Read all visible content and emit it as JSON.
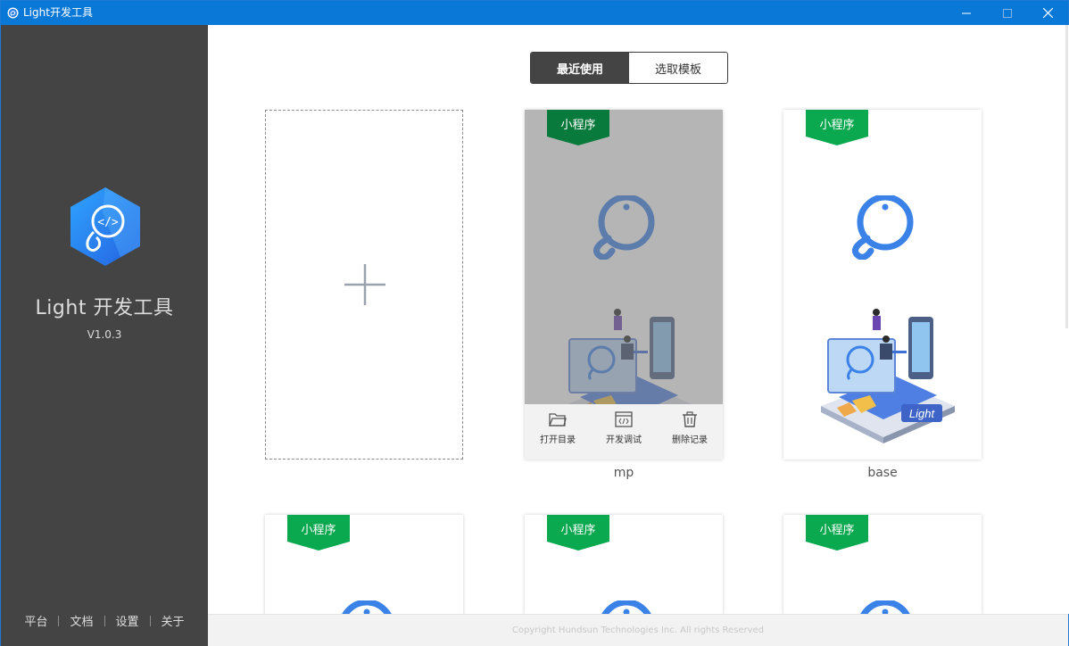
{
  "window": {
    "title": "Light开发工具",
    "controls": {
      "minimize": "minimize-icon",
      "maximize": "maximize-icon",
      "close": "close-icon"
    }
  },
  "sidebar": {
    "app_name": "Light 开发工具",
    "version": "V1.0.3",
    "links": [
      "平台",
      "文档",
      "设置",
      "关于"
    ]
  },
  "tabs": {
    "recent": "最近使用",
    "template": "选取模板",
    "active": "recent"
  },
  "cards": [
    {
      "badge": "小程序",
      "name": "mp",
      "hovered": true,
      "actions": [
        {
          "label": "打开目录",
          "icon": "folder-icon"
        },
        {
          "label": "开发调试",
          "icon": "code-icon"
        },
        {
          "label": "删除记录",
          "icon": "trash-icon"
        }
      ]
    },
    {
      "badge": "小程序",
      "name": "base",
      "hovered": false
    },
    {
      "badge": "小程序"
    },
    {
      "badge": "小程序"
    },
    {
      "badge": "小程序"
    }
  ],
  "illustration_label": "Light",
  "footer": {
    "copyright": "Copyright Hundsun Technologies Inc. All rights Reserved"
  },
  "colors": {
    "titlebar": "#0a78d7",
    "sidebar": "#444444",
    "badge": "#0aa84f",
    "logo_blue": "#3b82e8"
  }
}
